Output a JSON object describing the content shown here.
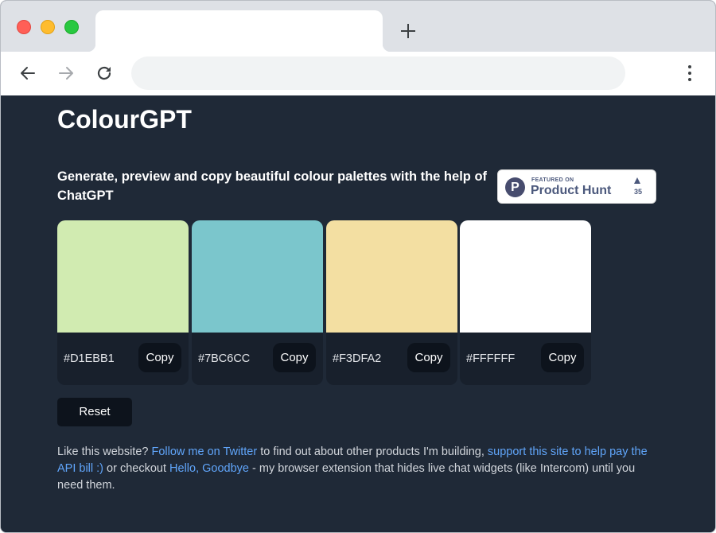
{
  "browser": {
    "tab_title": "",
    "address": "",
    "colors": {
      "tabstrip": "#dee1e6",
      "close": "#ff5f57",
      "minimize": "#febc2e",
      "maximize": "#28c840"
    }
  },
  "page": {
    "title": "ColourGPT",
    "subtitle": "Generate, preview and copy beautiful colour palettes with the help of ChatGPT",
    "badge": {
      "featured": "FEATURED ON",
      "name": "Product Hunt",
      "logo_letter": "P",
      "votes": "35"
    },
    "palette": [
      {
        "hex": "#D1EBB1",
        "copy_label": "Copy"
      },
      {
        "hex": "#7BC6CC",
        "copy_label": "Copy"
      },
      {
        "hex": "#F3DFA2",
        "copy_label": "Copy"
      },
      {
        "hex": "#FFFFFF",
        "copy_label": "Copy"
      }
    ],
    "reset_label": "Reset",
    "footer": {
      "t1": "Like this website? ",
      "link1": "Follow me on Twitter",
      "t2": " to find out about other products I'm building, ",
      "link2": "support this site to help pay the API bill :)",
      "t3": " or checkout ",
      "link3": "Hello, Goodbye",
      "t4": " - my browser extension that hides live chat widgets (like Intercom) until you need them."
    },
    "colors": {
      "background": "#1f2937",
      "card_footer": "#18202c",
      "button": "#0d131c",
      "link": "#60a5fa"
    }
  }
}
